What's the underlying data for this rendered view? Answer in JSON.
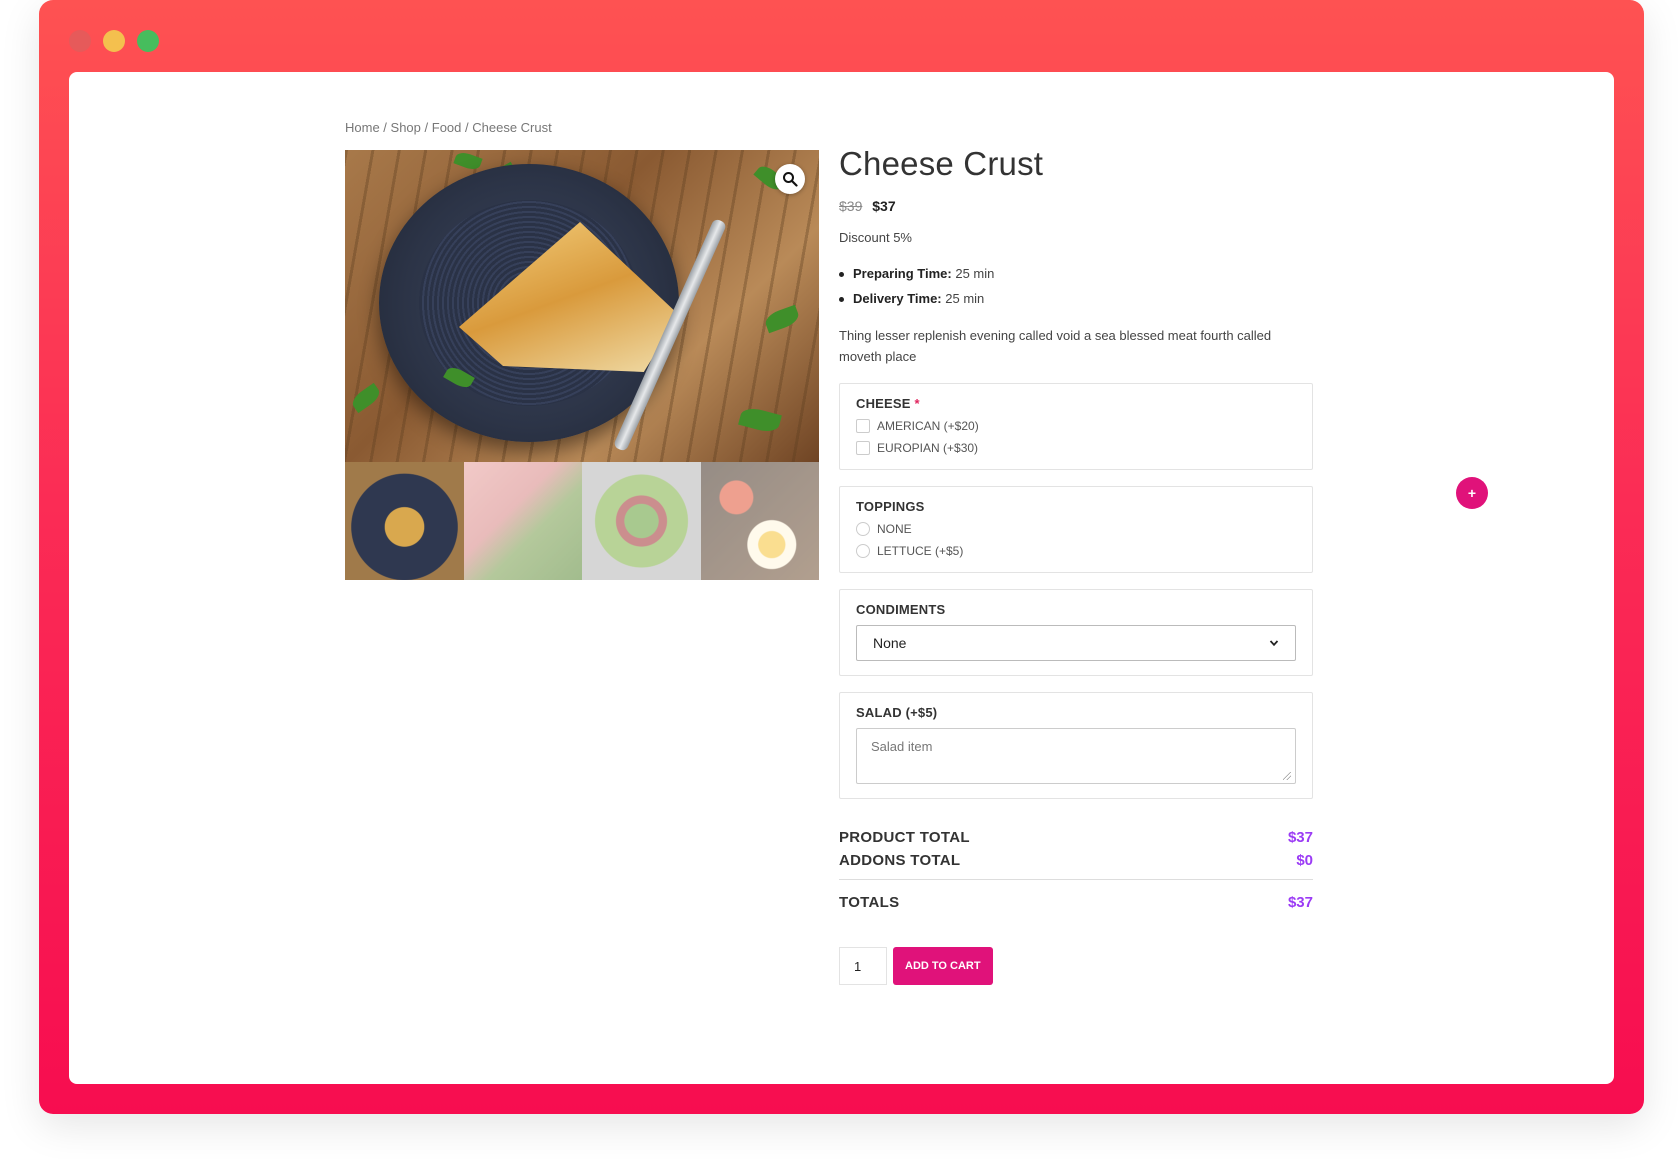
{
  "window": {
    "controls": [
      "close",
      "minimize",
      "maximize"
    ]
  },
  "breadcrumb": {
    "home": "Home",
    "shop": "Shop",
    "food": "Food",
    "current": "Cheese Crust",
    "sep": " / "
  },
  "product": {
    "title": "Cheese Crust",
    "old_price": "$39",
    "price": "$37",
    "discount": "Discount 5%",
    "preparing_label": "Preparing Time:",
    "preparing_value": " 25 min",
    "delivery_label": "Delivery Time:",
    "delivery_value": " 25 min",
    "description": "Thing lesser replenish evening called void a sea blessed meat fourth called moveth place"
  },
  "addons": {
    "cheese": {
      "title": "CHEESE",
      "required_mark": "*",
      "options": [
        "AMERICAN (+$20)",
        "EUROPIAN (+$30)"
      ]
    },
    "toppings": {
      "title": "TOPPINGS",
      "options": [
        "NONE",
        "LETTUCE (+$5)"
      ]
    },
    "condiments": {
      "title": "CONDIMENTS",
      "selected": "None"
    },
    "salad": {
      "title": "SALAD (+$5)",
      "placeholder": "Salad item"
    }
  },
  "totals": {
    "product_label": "PRODUCT TOTAL",
    "product_value": "$37",
    "addons_label": "ADDONS TOTAL",
    "addons_value": "$0",
    "totals_label": "TOTALS",
    "totals_value": "$37"
  },
  "cart": {
    "quantity": "1",
    "button": "ADD TO CART"
  },
  "fab": {
    "label": "+"
  },
  "colors": {
    "accent": "#e0127a",
    "totals": "#9b3bf5",
    "frame_top": "#fe5252",
    "frame_bottom": "#f70d50"
  }
}
